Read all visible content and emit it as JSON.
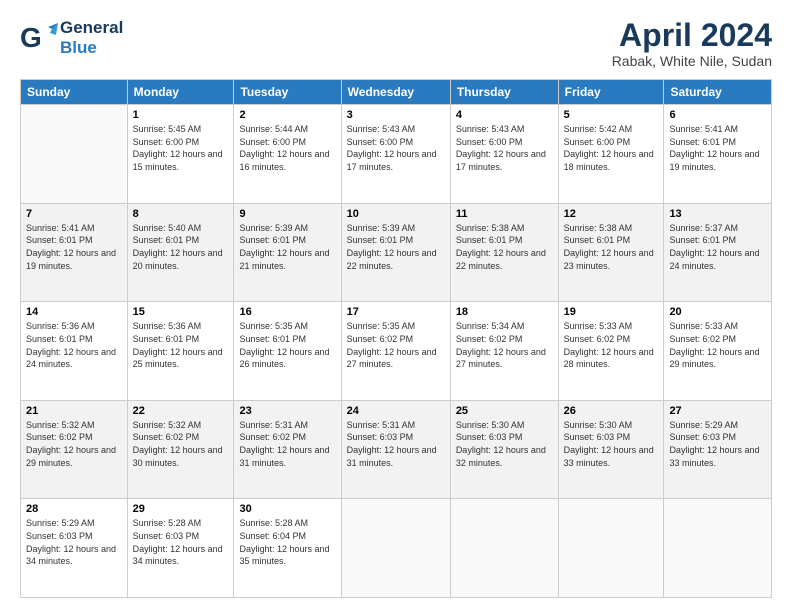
{
  "logo": {
    "line1": "General",
    "line2": "Blue"
  },
  "title": "April 2024",
  "subtitle": "Rabak, White Nile, Sudan",
  "days_header": [
    "Sunday",
    "Monday",
    "Tuesday",
    "Wednesday",
    "Thursday",
    "Friday",
    "Saturday"
  ],
  "weeks": [
    [
      {
        "num": "",
        "sunrise": "",
        "sunset": "",
        "daylight": ""
      },
      {
        "num": "1",
        "sunrise": "Sunrise: 5:45 AM",
        "sunset": "Sunset: 6:00 PM",
        "daylight": "Daylight: 12 hours and 15 minutes."
      },
      {
        "num": "2",
        "sunrise": "Sunrise: 5:44 AM",
        "sunset": "Sunset: 6:00 PM",
        "daylight": "Daylight: 12 hours and 16 minutes."
      },
      {
        "num": "3",
        "sunrise": "Sunrise: 5:43 AM",
        "sunset": "Sunset: 6:00 PM",
        "daylight": "Daylight: 12 hours and 17 minutes."
      },
      {
        "num": "4",
        "sunrise": "Sunrise: 5:43 AM",
        "sunset": "Sunset: 6:00 PM",
        "daylight": "Daylight: 12 hours and 17 minutes."
      },
      {
        "num": "5",
        "sunrise": "Sunrise: 5:42 AM",
        "sunset": "Sunset: 6:00 PM",
        "daylight": "Daylight: 12 hours and 18 minutes."
      },
      {
        "num": "6",
        "sunrise": "Sunrise: 5:41 AM",
        "sunset": "Sunset: 6:01 PM",
        "daylight": "Daylight: 12 hours and 19 minutes."
      }
    ],
    [
      {
        "num": "7",
        "sunrise": "Sunrise: 5:41 AM",
        "sunset": "Sunset: 6:01 PM",
        "daylight": "Daylight: 12 hours and 19 minutes."
      },
      {
        "num": "8",
        "sunrise": "Sunrise: 5:40 AM",
        "sunset": "Sunset: 6:01 PM",
        "daylight": "Daylight: 12 hours and 20 minutes."
      },
      {
        "num": "9",
        "sunrise": "Sunrise: 5:39 AM",
        "sunset": "Sunset: 6:01 PM",
        "daylight": "Daylight: 12 hours and 21 minutes."
      },
      {
        "num": "10",
        "sunrise": "Sunrise: 5:39 AM",
        "sunset": "Sunset: 6:01 PM",
        "daylight": "Daylight: 12 hours and 22 minutes."
      },
      {
        "num": "11",
        "sunrise": "Sunrise: 5:38 AM",
        "sunset": "Sunset: 6:01 PM",
        "daylight": "Daylight: 12 hours and 22 minutes."
      },
      {
        "num": "12",
        "sunrise": "Sunrise: 5:38 AM",
        "sunset": "Sunset: 6:01 PM",
        "daylight": "Daylight: 12 hours and 23 minutes."
      },
      {
        "num": "13",
        "sunrise": "Sunrise: 5:37 AM",
        "sunset": "Sunset: 6:01 PM",
        "daylight": "Daylight: 12 hours and 24 minutes."
      }
    ],
    [
      {
        "num": "14",
        "sunrise": "Sunrise: 5:36 AM",
        "sunset": "Sunset: 6:01 PM",
        "daylight": "Daylight: 12 hours and 24 minutes."
      },
      {
        "num": "15",
        "sunrise": "Sunrise: 5:36 AM",
        "sunset": "Sunset: 6:01 PM",
        "daylight": "Daylight: 12 hours and 25 minutes."
      },
      {
        "num": "16",
        "sunrise": "Sunrise: 5:35 AM",
        "sunset": "Sunset: 6:01 PM",
        "daylight": "Daylight: 12 hours and 26 minutes."
      },
      {
        "num": "17",
        "sunrise": "Sunrise: 5:35 AM",
        "sunset": "Sunset: 6:02 PM",
        "daylight": "Daylight: 12 hours and 27 minutes."
      },
      {
        "num": "18",
        "sunrise": "Sunrise: 5:34 AM",
        "sunset": "Sunset: 6:02 PM",
        "daylight": "Daylight: 12 hours and 27 minutes."
      },
      {
        "num": "19",
        "sunrise": "Sunrise: 5:33 AM",
        "sunset": "Sunset: 6:02 PM",
        "daylight": "Daylight: 12 hours and 28 minutes."
      },
      {
        "num": "20",
        "sunrise": "Sunrise: 5:33 AM",
        "sunset": "Sunset: 6:02 PM",
        "daylight": "Daylight: 12 hours and 29 minutes."
      }
    ],
    [
      {
        "num": "21",
        "sunrise": "Sunrise: 5:32 AM",
        "sunset": "Sunset: 6:02 PM",
        "daylight": "Daylight: 12 hours and 29 minutes."
      },
      {
        "num": "22",
        "sunrise": "Sunrise: 5:32 AM",
        "sunset": "Sunset: 6:02 PM",
        "daylight": "Daylight: 12 hours and 30 minutes."
      },
      {
        "num": "23",
        "sunrise": "Sunrise: 5:31 AM",
        "sunset": "Sunset: 6:02 PM",
        "daylight": "Daylight: 12 hours and 31 minutes."
      },
      {
        "num": "24",
        "sunrise": "Sunrise: 5:31 AM",
        "sunset": "Sunset: 6:03 PM",
        "daylight": "Daylight: 12 hours and 31 minutes."
      },
      {
        "num": "25",
        "sunrise": "Sunrise: 5:30 AM",
        "sunset": "Sunset: 6:03 PM",
        "daylight": "Daylight: 12 hours and 32 minutes."
      },
      {
        "num": "26",
        "sunrise": "Sunrise: 5:30 AM",
        "sunset": "Sunset: 6:03 PM",
        "daylight": "Daylight: 12 hours and 33 minutes."
      },
      {
        "num": "27",
        "sunrise": "Sunrise: 5:29 AM",
        "sunset": "Sunset: 6:03 PM",
        "daylight": "Daylight: 12 hours and 33 minutes."
      }
    ],
    [
      {
        "num": "28",
        "sunrise": "Sunrise: 5:29 AM",
        "sunset": "Sunset: 6:03 PM",
        "daylight": "Daylight: 12 hours and 34 minutes."
      },
      {
        "num": "29",
        "sunrise": "Sunrise: 5:28 AM",
        "sunset": "Sunset: 6:03 PM",
        "daylight": "Daylight: 12 hours and 34 minutes."
      },
      {
        "num": "30",
        "sunrise": "Sunrise: 5:28 AM",
        "sunset": "Sunset: 6:04 PM",
        "daylight": "Daylight: 12 hours and 35 minutes."
      },
      {
        "num": "",
        "sunrise": "",
        "sunset": "",
        "daylight": ""
      },
      {
        "num": "",
        "sunrise": "",
        "sunset": "",
        "daylight": ""
      },
      {
        "num": "",
        "sunrise": "",
        "sunset": "",
        "daylight": ""
      },
      {
        "num": "",
        "sunrise": "",
        "sunset": "",
        "daylight": ""
      }
    ]
  ],
  "row_shading": [
    false,
    true,
    false,
    true,
    false
  ]
}
